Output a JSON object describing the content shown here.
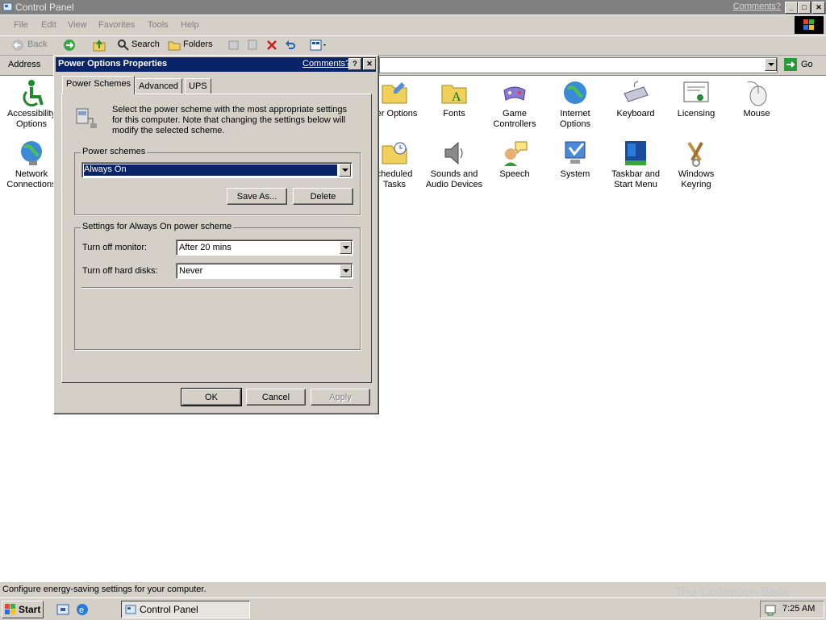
{
  "window": {
    "title": "Control Panel",
    "comments_link": "Comments?",
    "minimize": "_",
    "maximize": "□",
    "close": "✕"
  },
  "menubar": {
    "items": [
      "File",
      "Edit",
      "View",
      "Favorites",
      "Tools",
      "Help"
    ]
  },
  "toolbar": {
    "back": "Back",
    "search": "Search",
    "folders": "Folders"
  },
  "addressbar": {
    "label": "Address",
    "go": "Go"
  },
  "control_panel": {
    "items": [
      {
        "label": "Accessibility Options",
        "icon": "accessibility-icon"
      },
      {
        "label": "Network Connections",
        "icon": "network-icon"
      },
      {
        "label": "der Options",
        "icon": "folder-options-icon"
      },
      {
        "label": "Fonts",
        "icon": "fonts-folder-icon"
      },
      {
        "label": "Game Controllers",
        "icon": "gamepad-icon"
      },
      {
        "label": "Internet Options",
        "icon": "globe-icon"
      },
      {
        "label": "Keyboard",
        "icon": "keyboard-icon"
      },
      {
        "label": "Licensing",
        "icon": "certificate-icon"
      },
      {
        "label": "Mouse",
        "icon": "mouse-icon"
      },
      {
        "label": "cheduled Tasks",
        "icon": "scheduled-tasks-icon"
      },
      {
        "label": "Sounds and Audio Devices",
        "icon": "speaker-icon"
      },
      {
        "label": "Speech",
        "icon": "speech-icon"
      },
      {
        "label": "System",
        "icon": "system-icon"
      },
      {
        "label": "Taskbar and Start Menu",
        "icon": "taskbar-icon"
      },
      {
        "label": "Windows Keyring",
        "icon": "keyring-icon"
      }
    ]
  },
  "statusbar": {
    "text": "Configure energy-saving settings for your computer."
  },
  "taskbar": {
    "start": "Start",
    "task": "Control Panel",
    "clock": "7:25 AM",
    "watermark": "The Collection Book"
  },
  "dialog": {
    "title": "Power Options Properties",
    "comments": "Comments?",
    "help": "?",
    "close": "✕",
    "tabs": [
      "Power Schemes",
      "Advanced",
      "UPS"
    ],
    "intro": "Select the power scheme with the most appropriate settings for this computer. Note that changing the settings below will modify the selected scheme.",
    "schemes_group": "Power schemes",
    "scheme_value": "Always On",
    "save_as": "Save As...",
    "delete": "Delete",
    "settings_group": "Settings for Always On power scheme",
    "monitor_label": "Turn off monitor:",
    "monitor_value": "After 20 mins",
    "disks_label": "Turn off hard disks:",
    "disks_value": "Never",
    "ok": "OK",
    "cancel": "Cancel",
    "apply": "Apply"
  }
}
